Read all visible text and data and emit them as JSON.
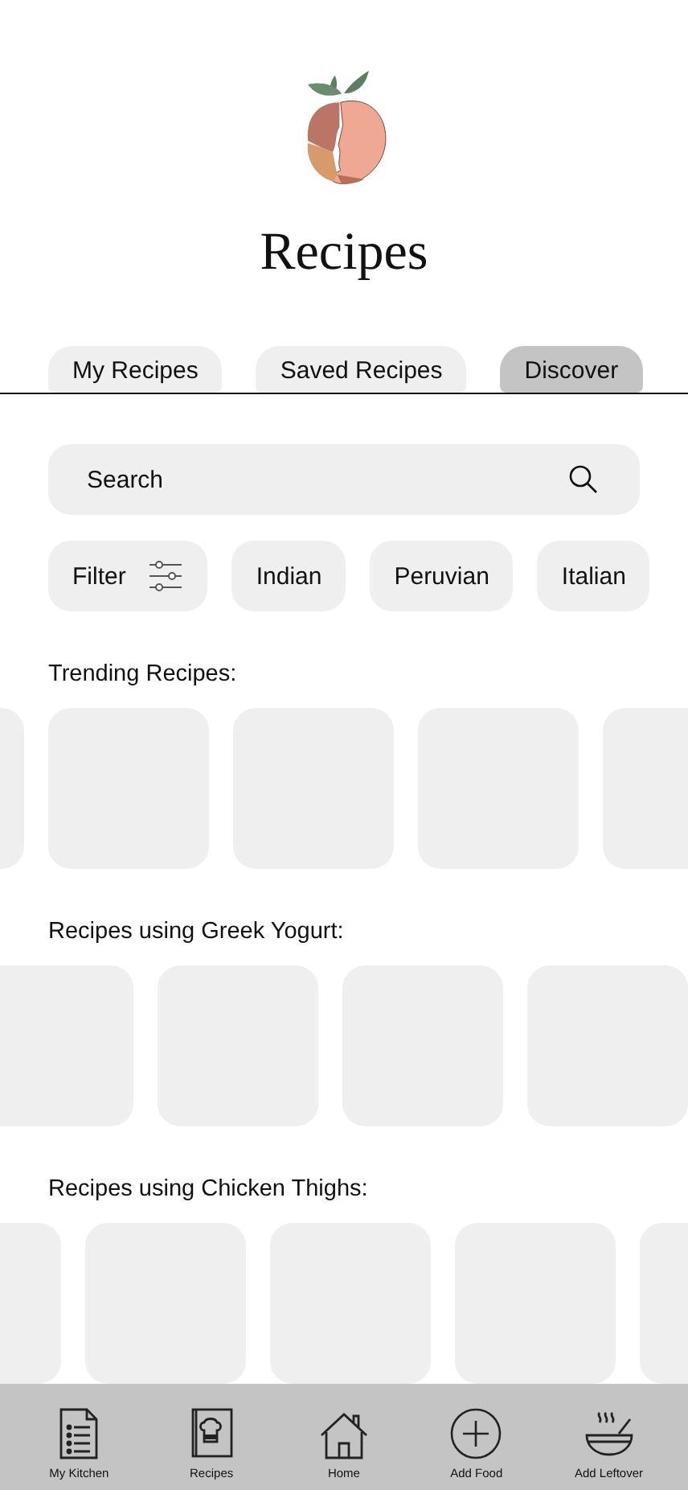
{
  "header": {
    "title": "Recipes"
  },
  "tabs": [
    {
      "label": "My Recipes",
      "selected": false
    },
    {
      "label": "Saved Recipes",
      "selected": false
    },
    {
      "label": "Discover",
      "selected": true
    }
  ],
  "search": {
    "placeholder": "Search"
  },
  "chips": [
    {
      "label": "Filter",
      "kind": "filter"
    },
    {
      "label": "Indian",
      "kind": "cuisine"
    },
    {
      "label": "Peruvian",
      "kind": "cuisine"
    },
    {
      "label": "Italian",
      "kind": "cuisine"
    }
  ],
  "sections": [
    {
      "title": "Trending Recipes:",
      "cards": [
        {
          "kind": "blank"
        },
        {
          "kind": "blank"
        },
        {
          "kind": "blank"
        },
        {
          "kind": "blank"
        },
        {
          "kind": "blank"
        }
      ]
    },
    {
      "title": "Recipes using Greek Yogurt:",
      "cards": [
        {
          "kind": "blank"
        },
        {
          "kind": "blank"
        },
        {
          "kind": "blank"
        },
        {
          "kind": "blank"
        }
      ]
    },
    {
      "title": "Recipes using Chicken Thighs:",
      "cards": [
        {
          "kind": "blank"
        },
        {
          "kind": "blank"
        },
        {
          "kind": "blank"
        },
        {
          "kind": "blank"
        },
        {
          "kind": "blank"
        }
      ]
    }
  ],
  "nav": [
    {
      "label": "My Kitchen",
      "kind": "list"
    },
    {
      "label": "Recipes",
      "kind": "book"
    },
    {
      "label": "Home",
      "kind": "home"
    },
    {
      "label": "Add Food",
      "kind": "plus"
    },
    {
      "label": "Add Leftover",
      "kind": "bowl"
    }
  ]
}
